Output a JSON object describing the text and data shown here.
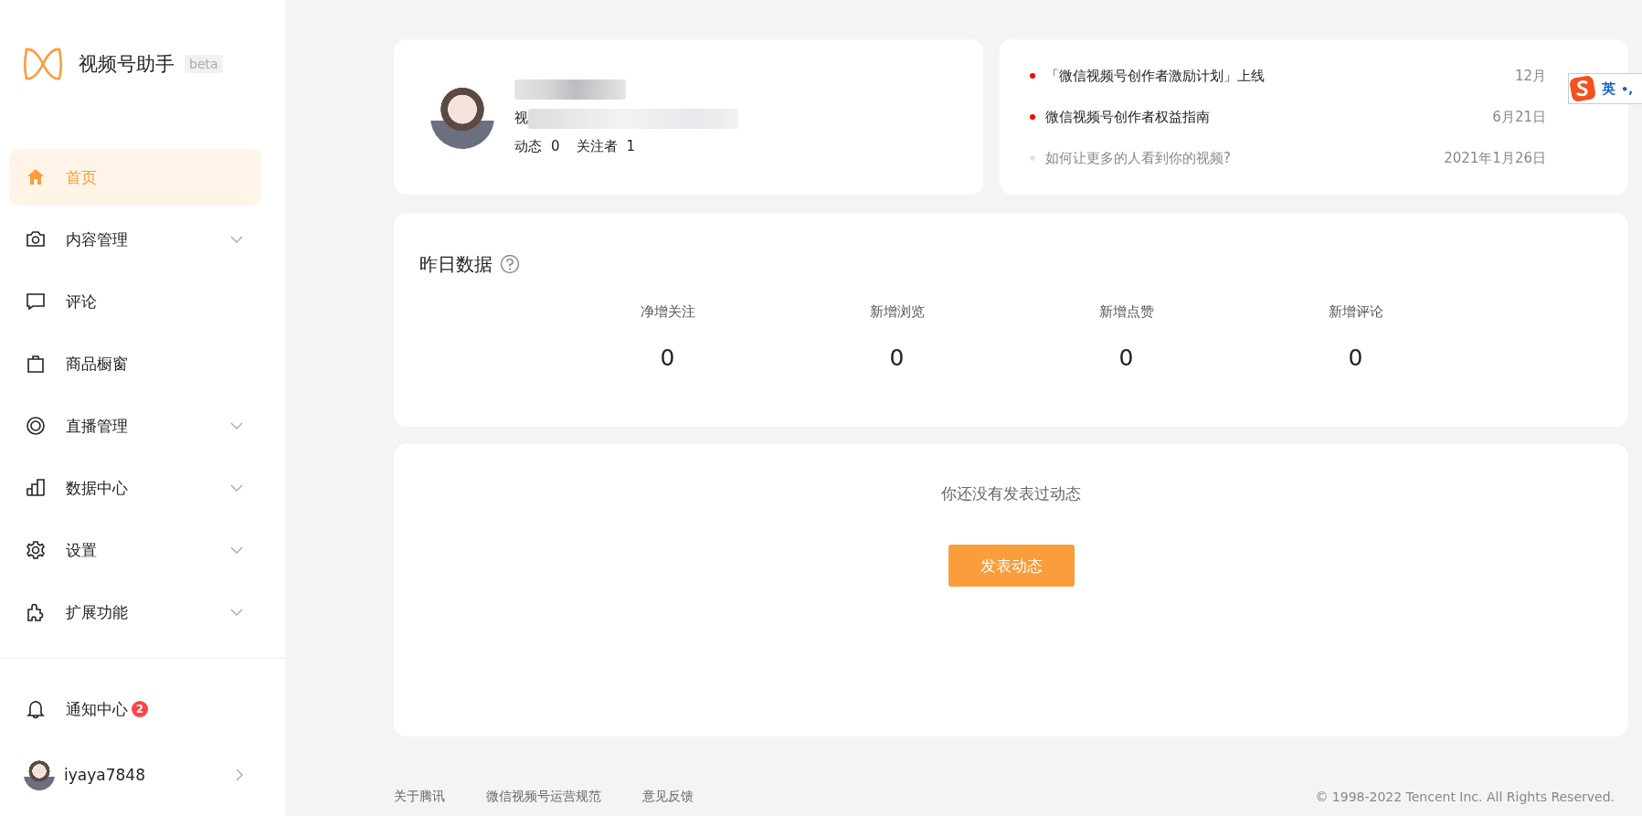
{
  "sidebar": {
    "logo_title": "视频号助手",
    "logo_badge": "beta",
    "items": [
      {
        "label": "首页",
        "selected": true,
        "expandable": false
      },
      {
        "label": "内容管理",
        "selected": false,
        "expandable": true
      },
      {
        "label": "评论",
        "selected": false,
        "expandable": false
      },
      {
        "label": "商品橱窗",
        "selected": false,
        "expandable": false
      },
      {
        "label": "直播管理",
        "selected": false,
        "expandable": true
      },
      {
        "label": "数据中心",
        "selected": false,
        "expandable": true
      },
      {
        "label": "设置",
        "selected": false,
        "expandable": true
      },
      {
        "label": "扩展功能",
        "selected": false,
        "expandable": true
      }
    ],
    "notifications": {
      "label": "通知中心",
      "count": "2"
    },
    "user": {
      "name": "iyaya7848"
    }
  },
  "profile": {
    "id_prefix": "视",
    "stats": [
      {
        "label": "动态",
        "value": "0"
      },
      {
        "label": "关注者",
        "value": "1"
      }
    ]
  },
  "news": [
    {
      "title": "「微信视频号创作者激励计划」上线",
      "date": "12月",
      "unread": true
    },
    {
      "title": "微信视频号创作者权益指南",
      "date": "6月21日",
      "unread": true
    },
    {
      "title": "如何让更多的人看到你的视频?",
      "date": "2021年1月26日",
      "unread": false
    }
  ],
  "yesterday": {
    "title": "昨日数据",
    "stats": [
      {
        "label": "净增关注",
        "value": "0"
      },
      {
        "label": "新增浏览",
        "value": "0"
      },
      {
        "label": "新增点赞",
        "value": "0"
      },
      {
        "label": "新增评论",
        "value": "0"
      }
    ]
  },
  "posts": {
    "empty_text": "你还没有发表过动态",
    "button": "发表动态"
  },
  "footer": {
    "links": [
      "关于腾讯",
      "微信视频号运营规范",
      "意见反馈"
    ],
    "copyright": "© 1998-2022 Tencent Inc. All Rights Reserved."
  },
  "ime_toolbar": {
    "mode": "英",
    "punctuation": "•,"
  }
}
